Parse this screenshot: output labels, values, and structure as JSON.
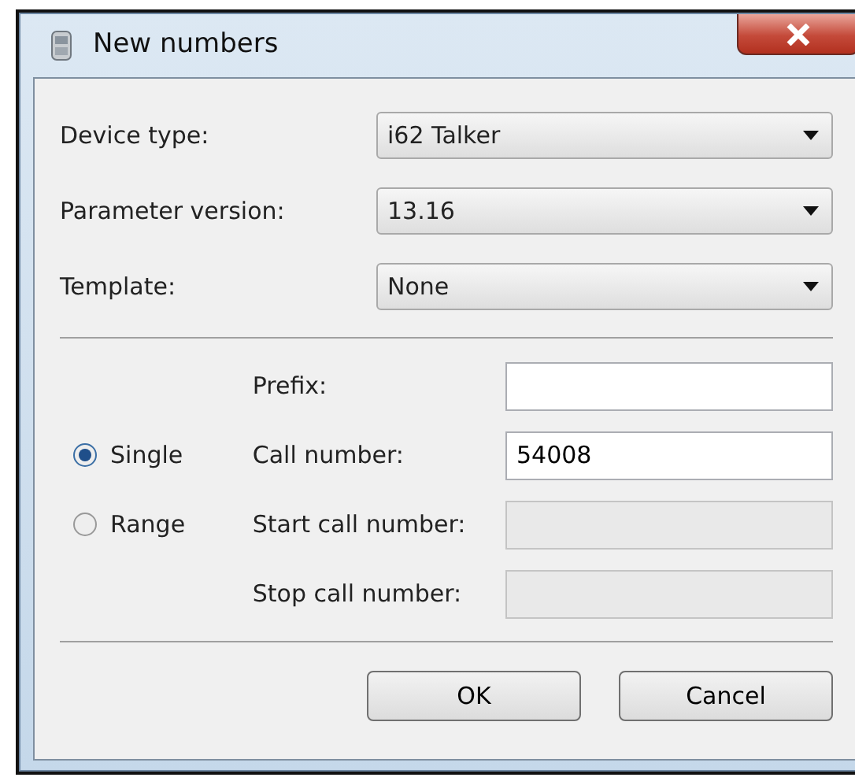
{
  "window": {
    "title": "New numbers"
  },
  "dropdowns": [
    {
      "label": "Device type:",
      "value": "i62 Talker"
    },
    {
      "label": "Parameter version:",
      "value": "13.16"
    },
    {
      "label": "Template:",
      "value": "None"
    }
  ],
  "number_rows": [
    {
      "label": "Prefix:",
      "disabled": false
    },
    {
      "radio": {
        "label": "Single",
        "selected": true
      },
      "label": "Call number:",
      "value": "54008",
      "disabled": false
    },
    {
      "radio": {
        "label": "Range",
        "selected": false
      },
      "label": "Start call number:",
      "disabled": true
    },
    {
      "label": "Stop call number:",
      "disabled": true
    }
  ],
  "buttons": [
    "OK",
    "Cancel"
  ]
}
